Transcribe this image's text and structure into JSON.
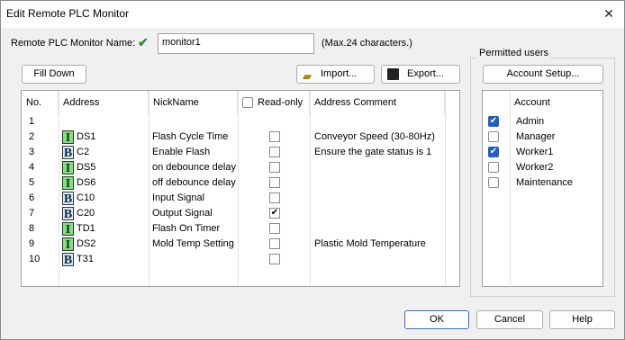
{
  "window": {
    "title": "Edit Remote PLC Monitor",
    "close_glyph": "✕"
  },
  "name_row": {
    "label": "Remote PLC Monitor Name:",
    "status_icon": "check-icon",
    "value": "monitor1",
    "hint": "(Max.24 characters.)"
  },
  "toolbar": {
    "fill_down": "Fill Down",
    "import": "Import...",
    "export": "Export...",
    "account_setup": "Account Setup..."
  },
  "table": {
    "headers": {
      "no": "No.",
      "address": "Address",
      "nickname": "NickName",
      "readonly": "Read-only",
      "comment": "Address Comment"
    },
    "rows": [
      {
        "no": "1",
        "type": "",
        "address": "",
        "nickname": "",
        "readonly": false,
        "comment": ""
      },
      {
        "no": "2",
        "type": "I",
        "address": "DS1",
        "nickname": "Flash Cycle Time",
        "readonly": false,
        "comment": "Conveyor Speed (30-80Hz)"
      },
      {
        "no": "3",
        "type": "B",
        "address": "C2",
        "nickname": "Enable Flash",
        "readonly": false,
        "comment": "Ensure the gate status is 1"
      },
      {
        "no": "4",
        "type": "I",
        "address": "DS5",
        "nickname": "on debounce delay",
        "readonly": false,
        "comment": ""
      },
      {
        "no": "5",
        "type": "I",
        "address": "DS6",
        "nickname": "off debounce delay",
        "readonly": false,
        "comment": ""
      },
      {
        "no": "6",
        "type": "B",
        "address": "C10",
        "nickname": "Input Signal",
        "readonly": false,
        "comment": ""
      },
      {
        "no": "7",
        "type": "B",
        "address": "C20",
        "nickname": "Output Signal",
        "readonly": true,
        "comment": ""
      },
      {
        "no": "8",
        "type": "I",
        "address": "TD1",
        "nickname": "Flash On Timer",
        "readonly": false,
        "comment": ""
      },
      {
        "no": "9",
        "type": "I",
        "address": "DS2",
        "nickname": "Mold Temp Setting",
        "readonly": false,
        "comment": "Plastic Mold Temperature"
      },
      {
        "no": "10",
        "type": "B",
        "address": "T31",
        "nickname": "",
        "readonly": false,
        "comment": ""
      }
    ]
  },
  "users": {
    "group_label": "Permitted users",
    "header": "Account",
    "items": [
      {
        "name": "Admin",
        "checked": true
      },
      {
        "name": "Manager",
        "checked": false
      },
      {
        "name": "Worker1",
        "checked": true
      },
      {
        "name": "Worker2",
        "checked": false
      },
      {
        "name": "Maintenance",
        "checked": false
      }
    ]
  },
  "footer": {
    "ok": "OK",
    "cancel": "Cancel",
    "help": "Help"
  },
  "colors": {
    "accent": "#1f5fc0",
    "int_icon": "#7fe07f",
    "bit_icon": "#d6e9f7",
    "ok_border": "#2a6ed6"
  }
}
